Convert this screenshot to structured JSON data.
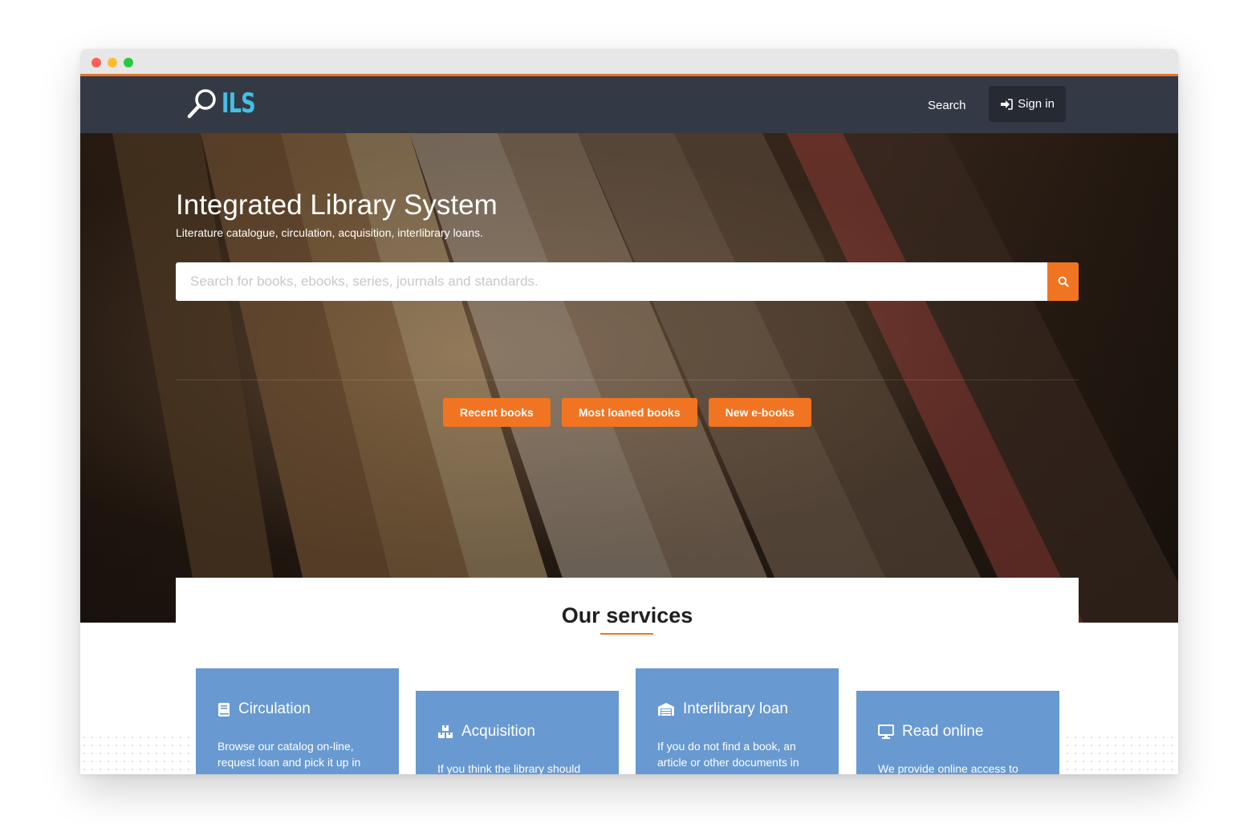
{
  "brand": {
    "logo_text": "ILS"
  },
  "nav": {
    "search_label": "Search",
    "signin_label": "Sign in"
  },
  "hero": {
    "title": "Integrated Library System",
    "subtitle": "Literature catalogue, circulation, acquisition, interlibrary loans.",
    "search_placeholder": "Search for books, ebooks, series, journals and standards.",
    "quick_links": [
      "Recent books",
      "Most loaned books",
      "New e-books"
    ]
  },
  "services": {
    "title": "Our services",
    "cards": [
      {
        "title": "Circulation",
        "icon": "book-icon",
        "text": "Browse our catalog on-line, request loan and pick it up in"
      },
      {
        "title": "Acquisition",
        "icon": "boxes-icon",
        "text": "If you think the library should"
      },
      {
        "title": "Interlibrary loan",
        "icon": "warehouse-icon",
        "text": "If you do not find a book, an article or other documents in"
      },
      {
        "title": "Read online",
        "icon": "desktop-icon",
        "text": "We provide online access to"
      }
    ]
  },
  "colors": {
    "accent": "#f07422",
    "navbar": "#343a45",
    "card": "#6899d1",
    "logo": "#43c0e4"
  }
}
